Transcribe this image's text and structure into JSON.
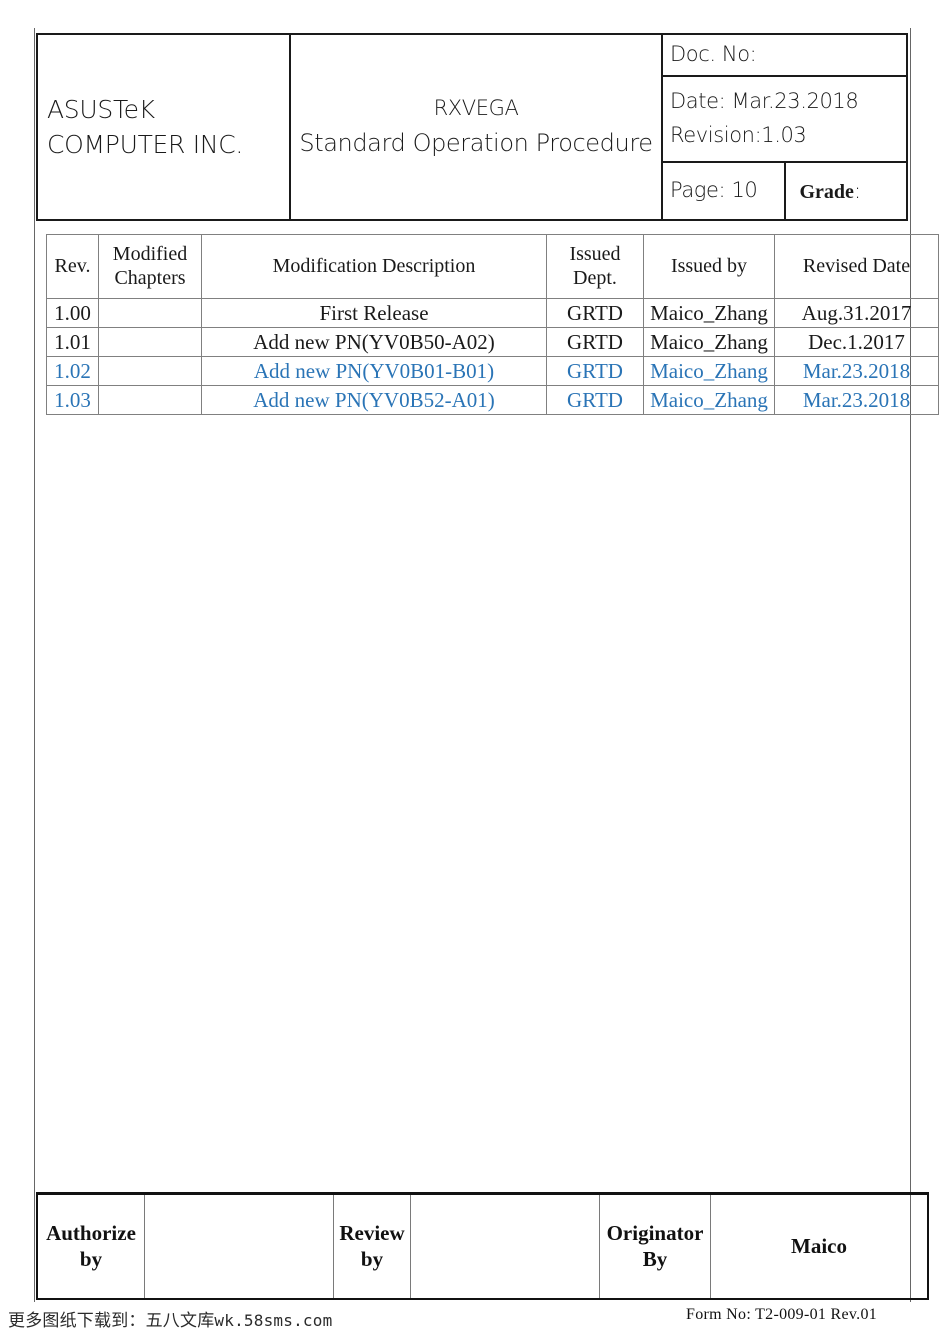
{
  "header": {
    "company_line1": "ASUSTeK",
    "company_line2": "COMPUTER INC.",
    "doc_title_line1": "RXVEGA",
    "doc_title_line2": "Standard Operation Procedure",
    "doc_no_label": "Doc. No:",
    "date_line": "Date: Mar.23.2018",
    "revision_line": "Revision:1.03",
    "page_label": "Page: 10",
    "grade_label": "Grade",
    "grade_colon": ":"
  },
  "revision_table": {
    "columns": [
      "Rev.",
      "Modified Chapters",
      "Modification Description",
      "Issued Dept.",
      "Issued by",
      "Revised Date"
    ],
    "columns_wrapped": [
      [
        "Rev."
      ],
      [
        "Modified",
        "Chapters"
      ],
      [
        "Modification Description"
      ],
      [
        "Issued",
        "Dept."
      ],
      [
        "Issued by"
      ],
      [
        "Revised Date"
      ]
    ],
    "rows": [
      {
        "rev": "1.00",
        "chapters": "",
        "description": "First Release",
        "dept": "GRTD",
        "issued_by": "Maico_Zhang",
        "revised_date": "Aug.31.2017",
        "highlighted": false
      },
      {
        "rev": "1.01",
        "chapters": "",
        "description": "Add new PN(YV0B50-A02)",
        "dept": "GRTD",
        "issued_by": "Maico_Zhang",
        "revised_date": "Dec.1.2017",
        "highlighted": false
      },
      {
        "rev": "1.02",
        "chapters": "",
        "description": "Add new PN(YV0B01-B01)",
        "dept": "GRTD",
        "issued_by": "Maico_Zhang",
        "revised_date": "Mar.23.2018",
        "highlighted": true
      },
      {
        "rev": "1.03",
        "chapters": "",
        "description": "Add new PN(YV0B52-A01)",
        "dept": "GRTD",
        "issued_by": "Maico_Zhang",
        "revised_date": "Mar.23.2018",
        "highlighted": true
      }
    ],
    "highlight_color": "#2a74b6"
  },
  "signature_table": {
    "authorize_line1": "Authorize",
    "authorize_line2": "by",
    "authorize_value": "",
    "review_line1": "Review",
    "review_line2": "by",
    "review_value": "",
    "originator_line1": "Originator",
    "originator_line2": "By",
    "originator_value": "Maico"
  },
  "footer": {
    "watermark_cjk": "更多图纸下载到：五八文库",
    "watermark_url": "wk.58sms.com",
    "form_no": "Form  No:  T2-009-01  Rev.01"
  }
}
